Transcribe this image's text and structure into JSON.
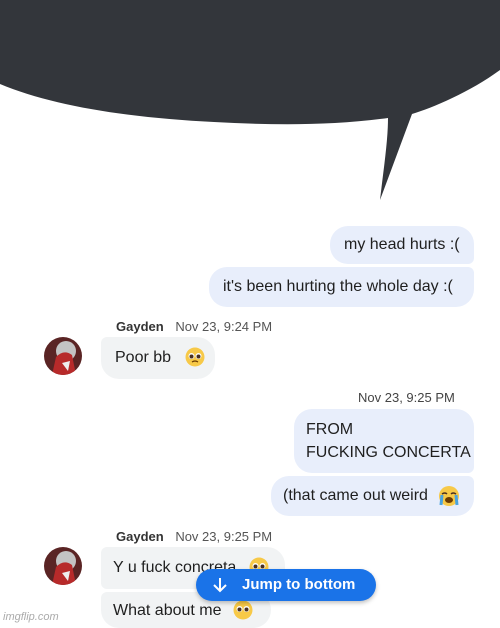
{
  "messages_out": [
    {
      "text": "my head hurts :("
    },
    {
      "text": "it's been hurting the whole day :("
    }
  ],
  "group1": {
    "sender": "Gayden",
    "time": "Nov 23, 9:24 PM",
    "message": "Poor bb"
  },
  "out_time": "Nov 23, 9:25 PM",
  "out2": {
    "line1": "FROM",
    "line2": "FUCKING CONCERTA",
    "line3": "(that came out weird"
  },
  "group2": {
    "sender": "Gayden",
    "time": "Nov 23, 9:25 PM",
    "message1": "Y u fuck concreta",
    "message2": "What about me"
  },
  "jump_button": {
    "label": "Jump to bottom"
  },
  "watermark": "imgflip.com",
  "colors": {
    "speech_bubble": "#33363b",
    "outgoing_bubble": "#e8eefb",
    "incoming_bubble": "#f1f3f4",
    "accent": "#1a73e8"
  },
  "icons": [
    "pleading-face-emoji",
    "crying-face-emoji",
    "arrow-down-icon",
    "avatar"
  ]
}
